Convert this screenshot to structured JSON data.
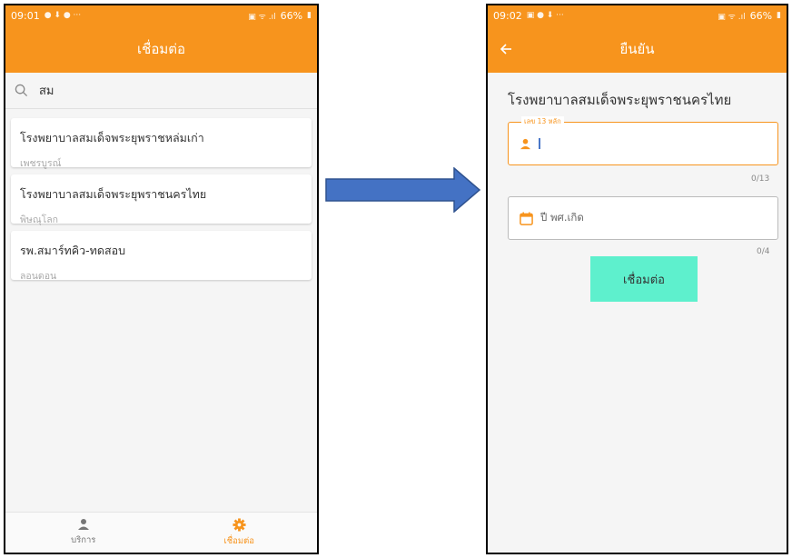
{
  "colors": {
    "accent": "#f7941d",
    "button": "#5ef0cd",
    "arrow": "#4472c4"
  },
  "screen1": {
    "status_time": "09:01",
    "status_right": "66%",
    "title": "เชื่อมต่อ",
    "search": {
      "value": "สม",
      "icon": "search-icon"
    },
    "hospitals": [
      {
        "name": "โรงพยาบาลสมเด็จพระยุพราชหล่มเก่า",
        "province": "เพชรบูรณ์"
      },
      {
        "name": "โรงพยาบาลสมเด็จพระยุพราชนครไทย",
        "province": "พิษณุโลก"
      },
      {
        "name": "รพ.สมาร์ทคิว-ทดสอบ",
        "province": "ลอนดอน"
      }
    ],
    "nav": [
      {
        "label": "บริการ",
        "icon": "person-icon",
        "active": false
      },
      {
        "label": "เชื่อมต่อ",
        "icon": "gear-icon",
        "active": true
      }
    ]
  },
  "screen2": {
    "status_time": "09:02",
    "status_right": "66%",
    "title": "ยืนยัน",
    "back_icon": "arrow-left-icon",
    "hospital_name": "โรงพยาบาลสมเด็จพระยุพราชนครไทย",
    "id_field": {
      "legend": "เลข 13 หลัก",
      "value": "",
      "counter": "0/13"
    },
    "year_field": {
      "placeholder": "ปี พศ.เกิด",
      "counter": "0/4"
    },
    "connect_label": "เชื่อมต่อ"
  }
}
